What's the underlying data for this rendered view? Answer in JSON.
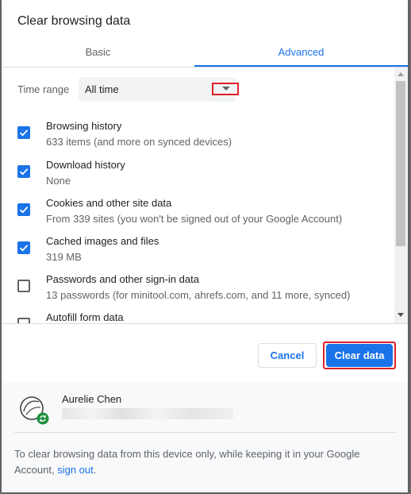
{
  "dialog": {
    "title": "Clear browsing data"
  },
  "tabs": [
    {
      "label": "Basic"
    },
    {
      "label": "Advanced"
    }
  ],
  "time_range": {
    "label": "Time range",
    "value": "All time"
  },
  "options": [
    {
      "title": "Browsing history",
      "subtitle": "633 items (and more on synced devices)",
      "checked": true
    },
    {
      "title": "Download history",
      "subtitle": "None",
      "checked": true
    },
    {
      "title": "Cookies and other site data",
      "subtitle": "From 339 sites (you won't be signed out of your Google Account)",
      "checked": true
    },
    {
      "title": "Cached images and files",
      "subtitle": "319 MB",
      "checked": true
    },
    {
      "title": "Passwords and other sign-in data",
      "subtitle": "13 passwords (for minitool.com, ahrefs.com, and 11 more, synced)",
      "checked": false
    },
    {
      "title": "Autofill form data",
      "subtitle": "",
      "checked": false
    }
  ],
  "buttons": {
    "cancel": "Cancel",
    "clear": "Clear data"
  },
  "account": {
    "name": "Aurelie Chen"
  },
  "footer": {
    "text": "To clear browsing data from this device only, while keeping it in your Google Account,",
    "link": "sign out",
    "suffix": "."
  },
  "colors": {
    "accent": "#1a73e8",
    "highlight": "#e0202a",
    "sync_badge": "#1e8e3e"
  }
}
